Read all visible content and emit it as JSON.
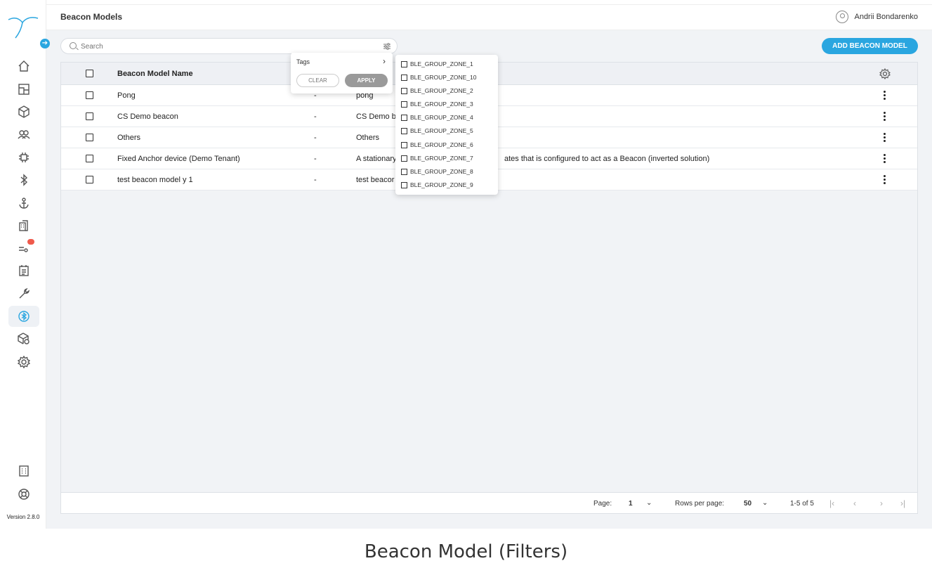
{
  "app": {
    "version": "Version 2.8.0",
    "page_title": "Beacon Models",
    "user_name": "Andrii Bondarenko"
  },
  "sidebar": {
    "items": [
      {
        "icon": "home-icon"
      },
      {
        "icon": "dashboard-icon"
      },
      {
        "icon": "cube-icon"
      },
      {
        "icon": "users-icon"
      },
      {
        "icon": "chip-icon"
      },
      {
        "icon": "bluetooth-icon"
      },
      {
        "icon": "anchor-icon"
      },
      {
        "icon": "building-icon"
      },
      {
        "icon": "rules-icon"
      },
      {
        "icon": "report-icon"
      },
      {
        "icon": "wrench-icon"
      },
      {
        "icon": "bluetooth-circle-icon",
        "active": true
      },
      {
        "icon": "package-settings-icon"
      },
      {
        "icon": "gear-icon"
      }
    ],
    "bottom": [
      {
        "icon": "docs-icon"
      },
      {
        "icon": "support-icon"
      }
    ]
  },
  "toolbar": {
    "search_placeholder": "Search",
    "add_button": "ADD BEACON MODEL"
  },
  "table": {
    "header_name": "Beacon Model Name",
    "rows": [
      {
        "name": "Pong",
        "dash": "-",
        "desc": "pong"
      },
      {
        "name": "CS Demo beacon",
        "dash": "-",
        "desc": "CS Demo b"
      },
      {
        "name": "Others",
        "dash": "-",
        "desc": "Others"
      },
      {
        "name": "Fixed Anchor device (Demo Tenant)",
        "dash": "-",
        "desc": "A stationary",
        "desc_tail": "ates that is configured to act as a Beacon (inverted solution)"
      },
      {
        "name": "test beacon model y 1",
        "dash": "-",
        "desc": "test beacor"
      }
    ]
  },
  "pagination": {
    "page_label": "Page:",
    "page_value": "1",
    "rows_label": "Rows per page:",
    "rows_value": "50",
    "range": "1-5 of 5"
  },
  "filter": {
    "tags_label": "Tags",
    "clear": "CLEAR",
    "apply": "APPLY",
    "tag_options": [
      "BLE_GROUP_ZONE_1",
      "BLE_GROUP_ZONE_10",
      "BLE_GROUP_ZONE_2",
      "BLE_GROUP_ZONE_3",
      "BLE_GROUP_ZONE_4",
      "BLE_GROUP_ZONE_5",
      "BLE_GROUP_ZONE_6",
      "BLE_GROUP_ZONE_7",
      "BLE_GROUP_ZONE_8",
      "BLE_GROUP_ZONE_9"
    ]
  },
  "caption": "Beacon Model (Filters)",
  "colors": {
    "accent": "#2aa6e0",
    "badge": "#ef5a4c",
    "content_bg": "#f1f3f6"
  }
}
